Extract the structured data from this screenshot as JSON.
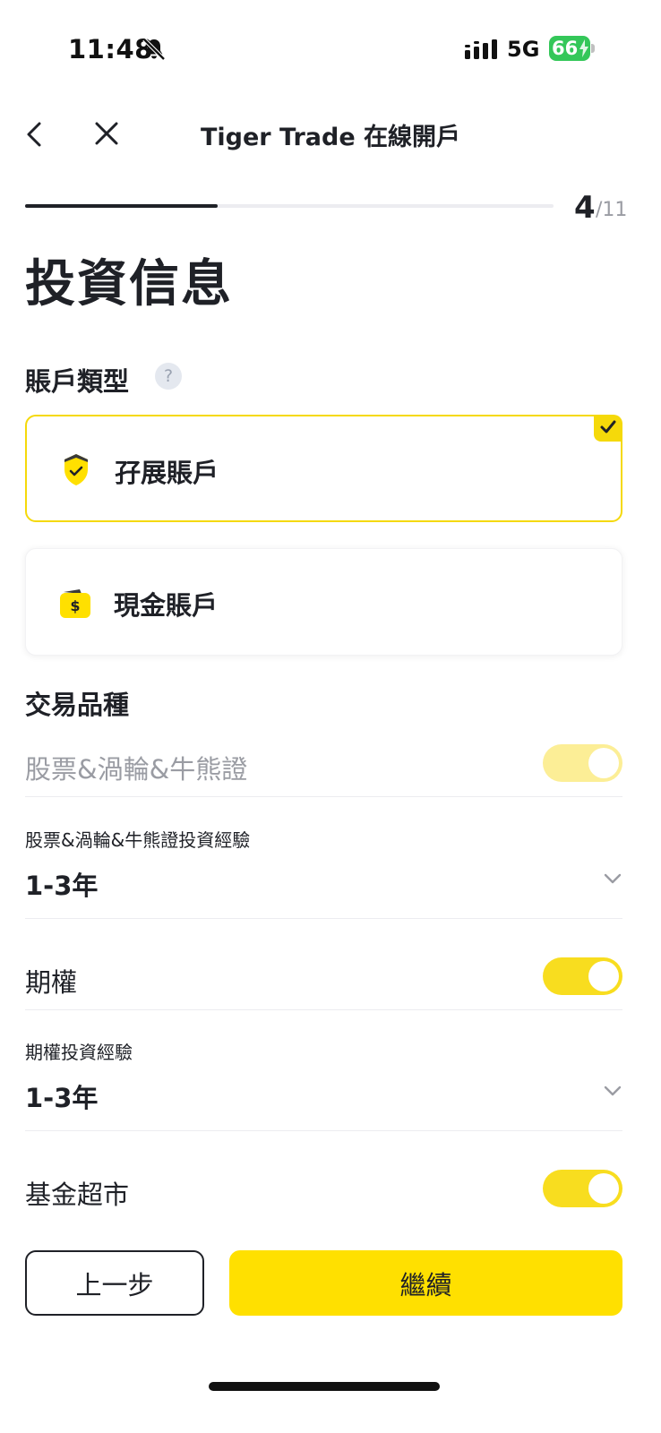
{
  "status_bar": {
    "time": "11:48",
    "network": "5G",
    "battery": "66"
  },
  "nav": {
    "title": "Tiger Trade 在線開戶"
  },
  "progress": {
    "current": "4",
    "total": "/11",
    "fraction": 0.364
  },
  "page_title": "投資信息",
  "account_type": {
    "label": "賬戶類型",
    "help": "?",
    "options": [
      {
        "label": "孖展賬戶",
        "selected": true,
        "icon": "shield-check-icon"
      },
      {
        "label": "現金賬戶",
        "selected": false,
        "icon": "wallet-dollar-icon"
      }
    ]
  },
  "products": {
    "label": "交易品種",
    "stocks": {
      "label": "股票&渦輪&牛熊證",
      "enabled": true,
      "locked": true
    },
    "stocks_experience": {
      "label": "股票&渦輪&牛熊證投資經驗",
      "value": "1-3年"
    },
    "options": {
      "label": "期權",
      "enabled": true
    },
    "options_experience": {
      "label": "期權投資經驗",
      "value": "1-3年"
    },
    "funds": {
      "label": "基金超市",
      "enabled": true
    }
  },
  "buttons": {
    "prev": "上一步",
    "next": "繼續"
  },
  "colors": {
    "accent": "#FFE000",
    "toggle_on": "#F8DD1F",
    "toggle_disabled": "#FCEE96",
    "battery": "#34C759"
  }
}
